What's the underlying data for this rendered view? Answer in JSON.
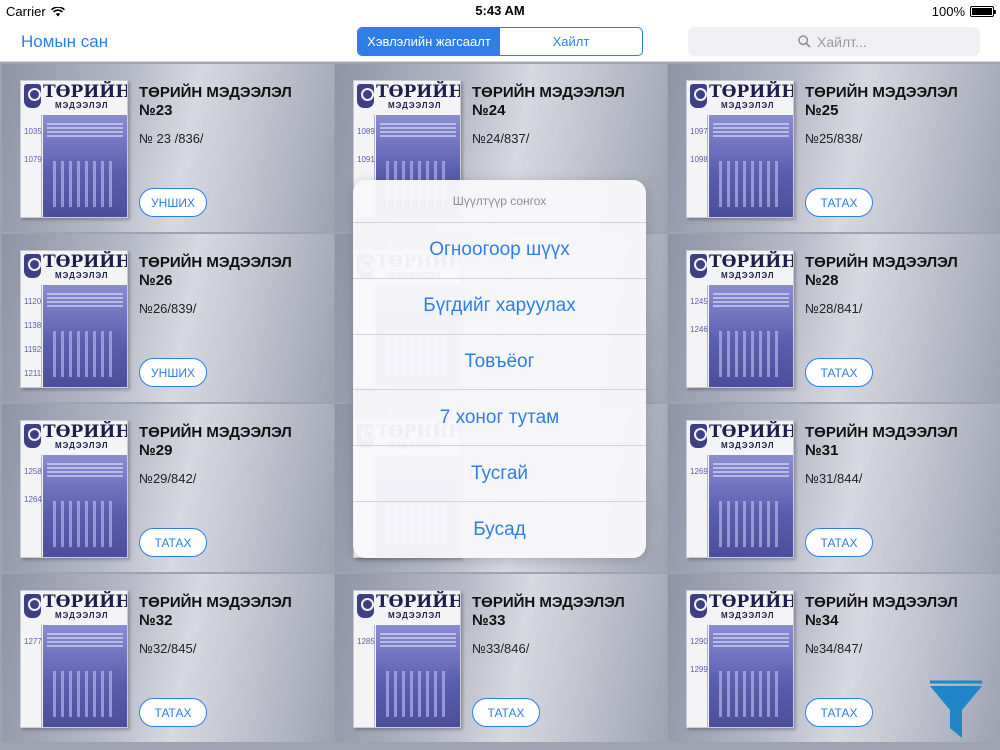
{
  "status_bar": {
    "carrier": "Carrier",
    "time": "5:43 AM",
    "battery": "100%"
  },
  "nav": {
    "back_title": "Номын сан",
    "segments": [
      "Хэвлэлийн жагсаалт",
      "Хайлт"
    ],
    "search_placeholder": "Хайлт..."
  },
  "issues": [
    {
      "title": "ТӨРИЙН МЭДЭЭЛЭЛ №23",
      "number": "№ 23 /836/",
      "action": "УНШИХ",
      "cover_numbers": [
        "1035",
        "1079"
      ]
    },
    {
      "title": "ТӨРИЙН МЭДЭЭЛЭЛ №24",
      "number": "№24/837/",
      "action": "",
      "cover_numbers": [
        "1089",
        "1091"
      ]
    },
    {
      "title": "ТӨРИЙН МЭДЭЭЛЭЛ №25",
      "number": "№25/838/",
      "action": "ТАТАХ",
      "cover_numbers": [
        "1097",
        "1098"
      ]
    },
    {
      "title": "ТӨРИЙН МЭДЭЭЛЭЛ №26",
      "number": "№26/839/",
      "action": "УНШИХ",
      "cover_numbers": [
        "1120",
        "1138",
        "1192",
        "1211"
      ]
    },
    {
      "title": "",
      "number": "",
      "action": "",
      "cover_numbers": []
    },
    {
      "title": "ТӨРИЙН МЭДЭЭЛЭЛ №28",
      "number": "№28/841/",
      "action": "ТАТАХ",
      "cover_numbers": [
        "1245",
        "1246"
      ]
    },
    {
      "title": "ТӨРИЙН МЭДЭЭЛЭЛ №29",
      "number": "№29/842/",
      "action": "ТАТАХ",
      "cover_numbers": [
        "1258",
        "1264"
      ]
    },
    {
      "title": "",
      "number": "",
      "action": "",
      "cover_numbers": []
    },
    {
      "title": "ТӨРИЙН МЭДЭЭЛЭЛ №31",
      "number": "№31/844/",
      "action": "ТАТАХ",
      "cover_numbers": [
        "1269"
      ]
    },
    {
      "title": "ТӨРИЙН МЭДЭЭЛЭЛ №32",
      "number": "№32/845/",
      "action": "ТАТАХ",
      "cover_numbers": [
        "1277"
      ]
    },
    {
      "title": "ТӨРИЙН МЭДЭЭЛЭЛ №33",
      "number": "№33/846/",
      "action": "ТАТАХ",
      "cover_numbers": [
        "1285"
      ]
    },
    {
      "title": "ТӨРИЙН МЭДЭЭЛЭЛ №34",
      "number": "№34/847/",
      "action": "ТАТАХ",
      "cover_numbers": [
        "1290",
        "1299"
      ]
    }
  ],
  "cover": {
    "masthead": "ТӨРИЙН",
    "masthead_sub": "МЭДЭЭЛЭЛ"
  },
  "filter_sheet": {
    "title": "Шүүлтүүр сонгох",
    "options": [
      "Огноогоор шүүх",
      "Бүгдийг харуулах",
      "Товъёог",
      "7 хоног тутам",
      "Тусгай",
      "Бусад"
    ]
  },
  "colors": {
    "accent": "#2f7ee8",
    "cover_ink": "#1e1f4a",
    "cover_blue": "#5a5eaf"
  }
}
